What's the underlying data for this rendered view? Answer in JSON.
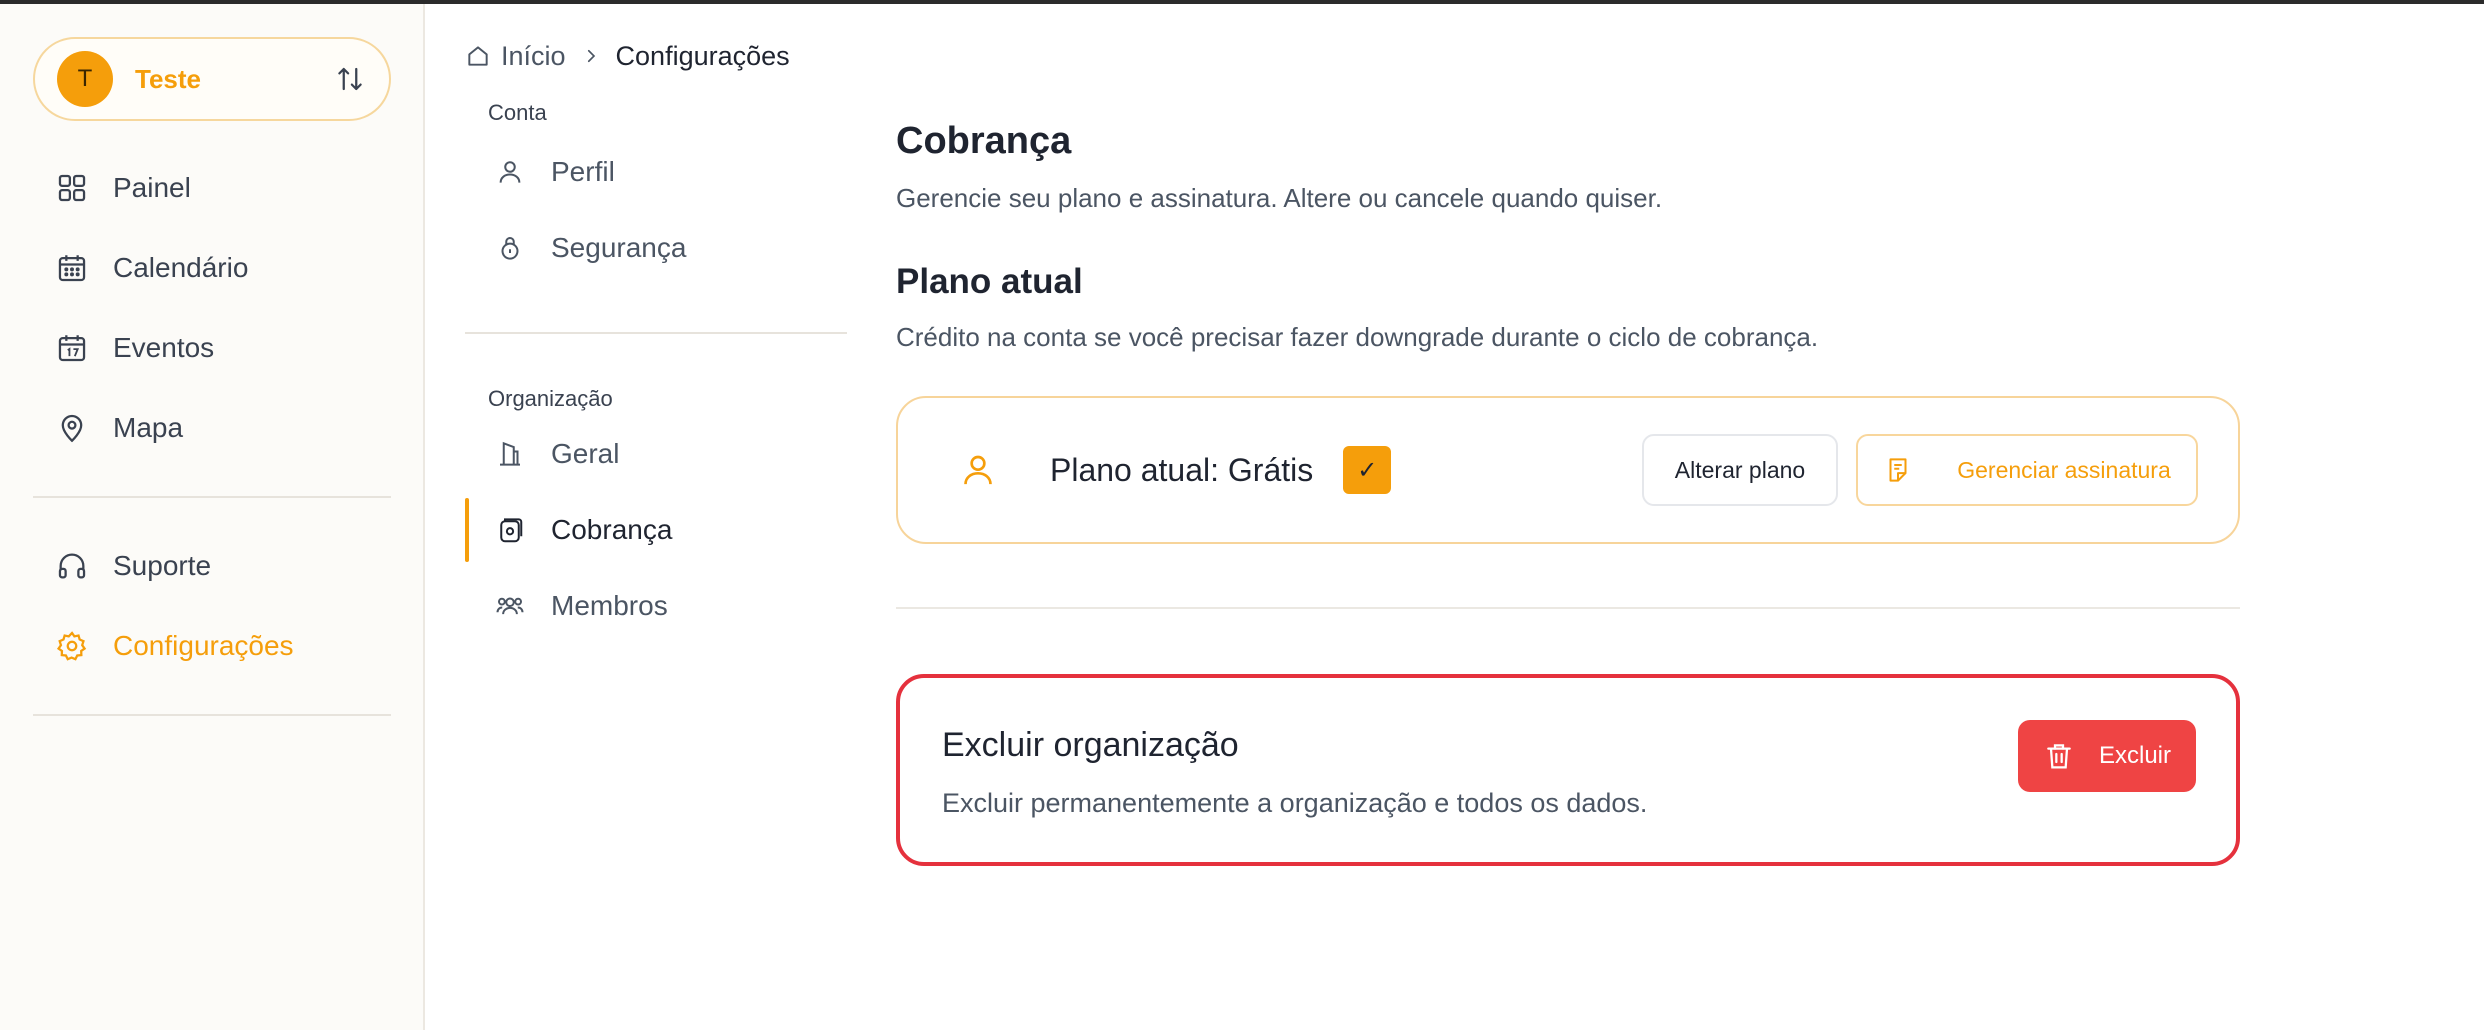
{
  "workspace": {
    "initial": "T",
    "name": "Teste"
  },
  "sidebar": {
    "items": [
      {
        "label": "Painel",
        "icon": "grid-icon"
      },
      {
        "label": "Calendário",
        "icon": "calendar-icon"
      },
      {
        "label": "Eventos",
        "icon": "calendar-day-icon"
      },
      {
        "label": "Mapa",
        "icon": "map-pin-icon"
      }
    ],
    "bottom_items": [
      {
        "label": "Suporte",
        "icon": "headphones-icon"
      },
      {
        "label": "Configurações",
        "icon": "gear-icon",
        "active": true
      }
    ]
  },
  "breadcrumb": {
    "home": "Início",
    "current": "Configurações"
  },
  "subnav": {
    "account_title": "Conta",
    "account_items": [
      "Perfil",
      "Segurança"
    ],
    "org_title": "Organização",
    "org_items": [
      "Geral",
      "Cobrança",
      "Membros"
    ],
    "active": "Cobrança"
  },
  "billing": {
    "title": "Cobrança",
    "description": "Gerencie seu plano e assinatura. Altere ou cancele quando quiser.",
    "plan_heading": "Plano atual",
    "plan_description": "Crédito na conta se você precisar fazer downgrade durante o ciclo de cobrança.",
    "plan_label": "Plano atual: Grátis",
    "check_glyph": "✓",
    "change_plan_label": "Alterar plano",
    "manage_label": "Gerenciar assinatura"
  },
  "danger": {
    "title": "Excluir organização",
    "description": "Excluir permanentemente a organização e todos os dados.",
    "button_label": "Excluir"
  },
  "colors": {
    "accent": "#f59e0b",
    "danger": "#ef4444",
    "danger_border": "#e5313d"
  }
}
